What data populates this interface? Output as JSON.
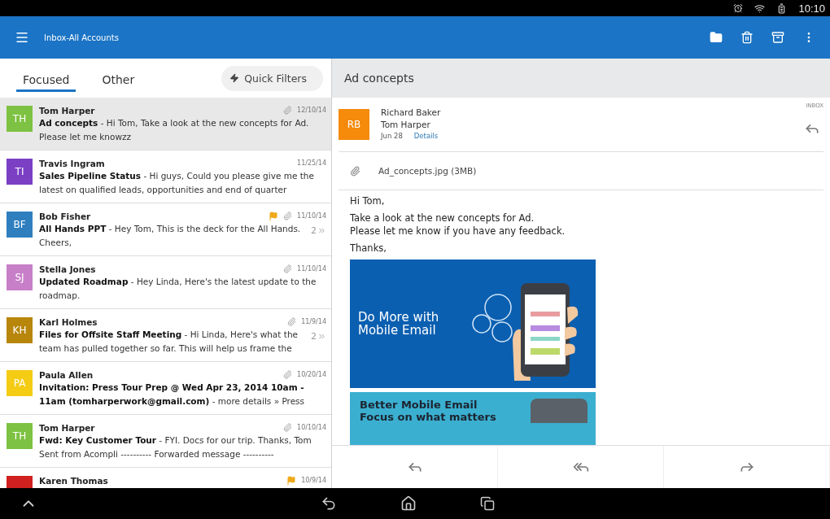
{
  "status_bar": {
    "time": "10:10"
  },
  "app_bar": {
    "title": "Inbox-All Accounts"
  },
  "tabs": [
    {
      "label": "Focused",
      "selected": true
    },
    {
      "label": "Other",
      "selected": false
    }
  ],
  "quick_filters": {
    "label": "Quick Filters"
  },
  "messages": [
    {
      "initials": "TH",
      "color": "#7dc242",
      "sender": "Tom Harper",
      "subject": "Ad concepts",
      "preview": "- Hi Tom, Take a look at the new concepts for Ad. Please let me knowzz",
      "date": "12/10/14",
      "attachment": true,
      "flagged": false,
      "selected": true
    },
    {
      "initials": "TI",
      "color": "#7b3fc4",
      "sender": "Travis Ingram",
      "subject": "Sales Pipeline Status",
      "preview": "- Hi guys, Could you please give me the latest on qualified leads, opportunities and end of quarter",
      "date": "11/25/14",
      "attachment": false,
      "flagged": false,
      "selected": false
    },
    {
      "initials": "BF",
      "color": "#2f7fbf",
      "sender": "Bob Fisher",
      "subject": "All Hands PPT",
      "preview": "- Hey Tom, This is the deck for the All Hands. Cheers,",
      "date": "11/10/14",
      "attachment": true,
      "flagged": true,
      "thread_count": "2",
      "selected": false
    },
    {
      "initials": "SJ",
      "color": "#c77fc8",
      "sender": "Stella Jones",
      "subject": "Updated Roadmap",
      "preview": "- Hey Linda, Here's the latest update to the roadmap.",
      "date": "11/10/14",
      "attachment": true,
      "flagged": false,
      "selected": false
    },
    {
      "initials": "KH",
      "color": "#b8860b",
      "sender": "Karl Holmes",
      "subject": "Files for Offsite Staff Meeting",
      "preview": "- Hi Linda, Here's what the team has pulled together so far. This will help us frame the",
      "date": "11/9/14",
      "attachment": true,
      "flagged": false,
      "thread_count": "2",
      "selected": false
    },
    {
      "initials": "PA",
      "color": "#f5cc14",
      "sender": "Paula Allen",
      "subject": "Invitation: Press Tour Prep @ Wed Apr 23, 2014 10am - 11am (tomharperwork@gmail.com)",
      "preview": "- more details » Press",
      "date": "10/20/14",
      "attachment": true,
      "flagged": false,
      "selected": false
    },
    {
      "initials": "TH",
      "color": "#7dc242",
      "sender": "Tom Harper",
      "subject": "Fwd: Key Customer Tour",
      "preview": "- FYI. Docs for our trip. Thanks, Tom Sent from Acompli ---------- Forwarded message ----------",
      "date": "10/10/14",
      "attachment": true,
      "flagged": false,
      "selected": false
    },
    {
      "color": "#d0201f",
      "sender": "Karen Thomas",
      "date": "10/9/14",
      "attachment": false,
      "flagged": true,
      "selected": false
    }
  ],
  "reading": {
    "subject": "Ad concepts",
    "avatar_initials": "RB",
    "from": "Richard Baker",
    "to": "Tom Harper",
    "date": "Jun 28",
    "details_link": "Details",
    "folder": "INBOX",
    "attachment": "Ad_concepts.jpg (3MB)",
    "body": [
      "Hi Tom,",
      "Take a look at the new concepts for Ad.\nPlease let me know if you have any feedback.",
      "Thanks,"
    ],
    "banner": {
      "headline": "Do More with\nMobile Email",
      "tagline": "Better Mobile Email\nFocus on what matters"
    }
  }
}
